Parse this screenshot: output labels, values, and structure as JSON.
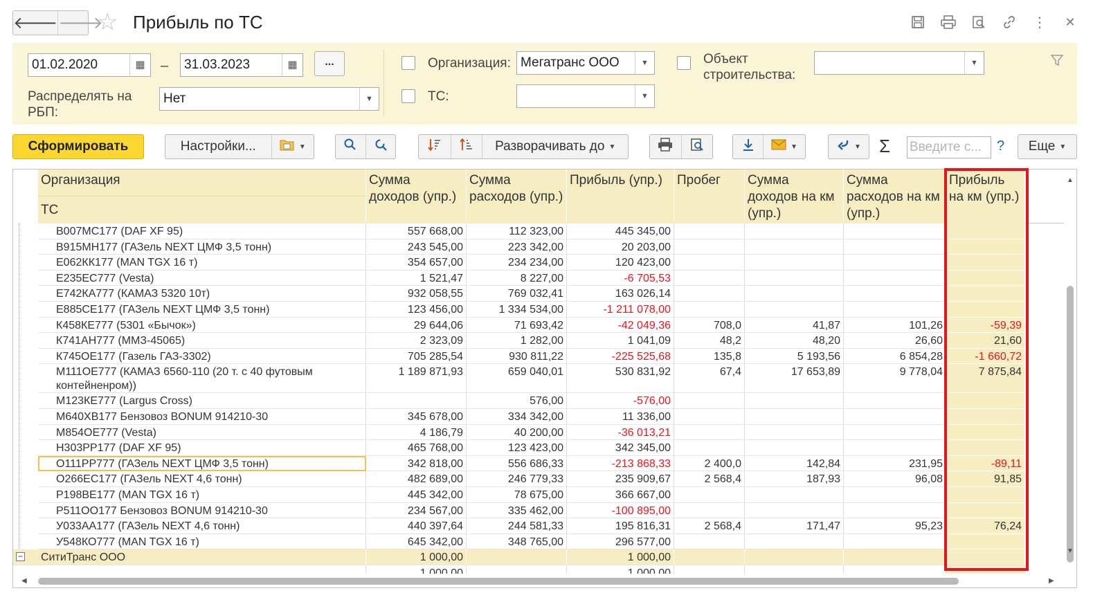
{
  "window": {
    "title": "Прибыль по ТС",
    "back_icon": "arrow-left-icon",
    "forward_icon": "arrow-right-icon",
    "favorite_icon": "star-icon",
    "icons": [
      "save-icon",
      "print-icon",
      "preview-icon",
      "link-icon",
      "more-vertical-icon",
      "close-icon"
    ]
  },
  "filters": {
    "date_from": "01.02.2020",
    "date_sep": "–",
    "date_to": "31.03.2023",
    "period_button": "...",
    "distribute_label": "Распределять на РБП:",
    "distribute_value": "Нет",
    "org_label": "Организация:",
    "org_value": "Мегатранс ООО",
    "org_checked": false,
    "ts_label": "ТС:",
    "ts_value": "",
    "ts_checked": false,
    "object_label": "Объект строительства:",
    "object_value": "",
    "object_checked": false
  },
  "toolbar": {
    "generate": "Сформировать",
    "settings": "Настройки...",
    "expand_to": "Разворачивать до",
    "search_placeholder": "Введите с...",
    "sum_symbol": "Σ",
    "help": "?",
    "more": "Еще"
  },
  "columns": {
    "org": "Организация",
    "ts": "ТС",
    "income": "Сумма доходов (упр.)",
    "expense": "Сумма расходов (упр.)",
    "profit": "Прибыль (упр.)",
    "mileage": "Пробег",
    "income_km": "Сумма доходов на км (упр.)",
    "expense_km": "Сумма расходов на км (упр.)",
    "profit_km": "Прибыль на км (упр.)"
  },
  "rows": [
    {
      "name": "В007МС177 (DAF XF 95)",
      "income": "557 668,00",
      "expense": "112 323,00",
      "profit": "445 345,00",
      "mileage": "",
      "income_km": "",
      "expense_km": "",
      "profit_km": ""
    },
    {
      "name": "В915МН177 (ГАЗель NEXT ЦМФ 3,5 тонн)",
      "income": "243 545,00",
      "expense": "223 342,00",
      "profit": "20 203,00",
      "mileage": "",
      "income_km": "",
      "expense_km": "",
      "profit_km": ""
    },
    {
      "name": "Е062КК177 (MAN TGX 16 т)",
      "income": "354 657,00",
      "expense": "234 234,00",
      "profit": "120 423,00",
      "mileage": "",
      "income_km": "",
      "expense_km": "",
      "profit_km": ""
    },
    {
      "name": "Е235ЕС777 (Vesta)",
      "income": "1 521,47",
      "expense": "8 227,00",
      "profit": "-6 705,53",
      "mileage": "",
      "income_km": "",
      "expense_km": "",
      "profit_km": ""
    },
    {
      "name": "Е742КА777 (КАМАЗ 5320 10т)",
      "income": "932 058,55",
      "expense": "769 032,41",
      "profit": "163 026,14",
      "mileage": "",
      "income_km": "",
      "expense_km": "",
      "profit_km": ""
    },
    {
      "name": "Е885СЕ177 (ГАЗель NEXT ЦМФ 3,5 тонн)",
      "income": "123 456,00",
      "expense": "1 334 534,00",
      "profit": "-1 211 078,00",
      "mileage": "",
      "income_km": "",
      "expense_km": "",
      "profit_km": ""
    },
    {
      "name": "К458КЕ777 (5301 «Бычок»)",
      "income": "29 644,06",
      "expense": "71 693,42",
      "profit": "-42 049,36",
      "mileage": "708,0",
      "income_km": "41,87",
      "expense_km": "101,26",
      "profit_km": "-59,39"
    },
    {
      "name": "К741АН777 (ММЗ-45065)",
      "income": "2 323,09",
      "expense": "1 282,00",
      "profit": "1 041,09",
      "mileage": "48,2",
      "income_km": "48,20",
      "expense_km": "26,60",
      "profit_km": "21,60"
    },
    {
      "name": "К745ОЕ177 (Газель ГАЗ-3302)",
      "income": "705 285,54",
      "expense": "930 811,22",
      "profit": "-225 525,68",
      "mileage": "135,8",
      "income_km": "5 193,56",
      "expense_km": "6 854,28",
      "profit_km": "-1 660,72"
    },
    {
      "name": "М111ОЕ777 (КАМАЗ 6560-110 (20 т. с 40 футовым контейненром))",
      "income": "1 189 871,93",
      "expense": "659 040,01",
      "profit": "530 831,92",
      "mileage": "67,4",
      "income_km": "17 653,89",
      "expense_km": "9 778,04",
      "profit_km": "7 875,84",
      "tall": true
    },
    {
      "name": "М123КЕ777 (Largus Cross)",
      "income": "",
      "expense": "576,00",
      "profit": "-576,00",
      "mileage": "",
      "income_km": "",
      "expense_km": "",
      "profit_km": ""
    },
    {
      "name": "М640ХВ177 Бензовоз BONUM 914210-30",
      "income": "345 678,00",
      "expense": "334 342,00",
      "profit": "11 336,00",
      "mileage": "",
      "income_km": "",
      "expense_km": "",
      "profit_km": ""
    },
    {
      "name": "М854ОЕ777 (Vesta)",
      "income": "4 186,79",
      "expense": "40 200,00",
      "profit": "-36 013,21",
      "mileage": "",
      "income_km": "",
      "expense_km": "",
      "profit_km": ""
    },
    {
      "name": "Н303РР177 (DAF XF 95)",
      "income": "465 768,00",
      "expense": "123 423,00",
      "profit": "342 345,00",
      "mileage": "",
      "income_km": "",
      "expense_km": "",
      "profit_km": ""
    },
    {
      "name": "О111РР777 (ГАЗель NEXT ЦМФ 3,5 тонн)",
      "income": "342 818,00",
      "expense": "556 686,33",
      "profit": "-213 868,33",
      "mileage": "2 400,0",
      "income_km": "142,84",
      "expense_km": "231,95",
      "profit_km": "-89,11",
      "selected": true
    },
    {
      "name": "О266ЕС177 (ГАЗель NEXT 4,6 тонн)",
      "income": "482 689,00",
      "expense": "246 779,33",
      "profit": "235 909,67",
      "mileage": "2 568,4",
      "income_km": "187,93",
      "expense_km": "96,08",
      "profit_km": "91,85"
    },
    {
      "name": "Р198ВЕ177 (MAN TGX 16 т)",
      "income": "445 342,00",
      "expense": "78 675,00",
      "profit": "366 667,00",
      "mileage": "",
      "income_km": "",
      "expense_km": "",
      "profit_km": ""
    },
    {
      "name": "Р511ОО177 Бензовоз BONUM 914210-30",
      "income": "234 567,00",
      "expense": "335 462,00",
      "profit": "-100 895,00",
      "mileage": "",
      "income_km": "",
      "expense_km": "",
      "profit_km": ""
    },
    {
      "name": "У033АА177 (ГАЗель NEXT 4,6 тонн)",
      "income": "440 397,64",
      "expense": "244 581,33",
      "profit": "195 816,31",
      "mileage": "2 568,4",
      "income_km": "171,47",
      "expense_km": "95,23",
      "profit_km": "76,24"
    },
    {
      "name": "У548КО777 (MAN TGX  16 т)",
      "income": "645 342,00",
      "expense": "348 765,00",
      "profit": "296 577,00",
      "mileage": "",
      "income_km": "",
      "expense_km": "",
      "profit_km": ""
    }
  ],
  "group_row": {
    "name": "СитиТранс ООО",
    "income": "1 000,00",
    "profit": "1 000,00"
  },
  "partial_row": {
    "income": "1 000,00",
    "profit": "1 000,00"
  },
  "colors": {
    "negative": "#e8141b",
    "header_bg": "#f6edc3",
    "highlight": "#e8141b",
    "primary_button": "#fcd732"
  }
}
